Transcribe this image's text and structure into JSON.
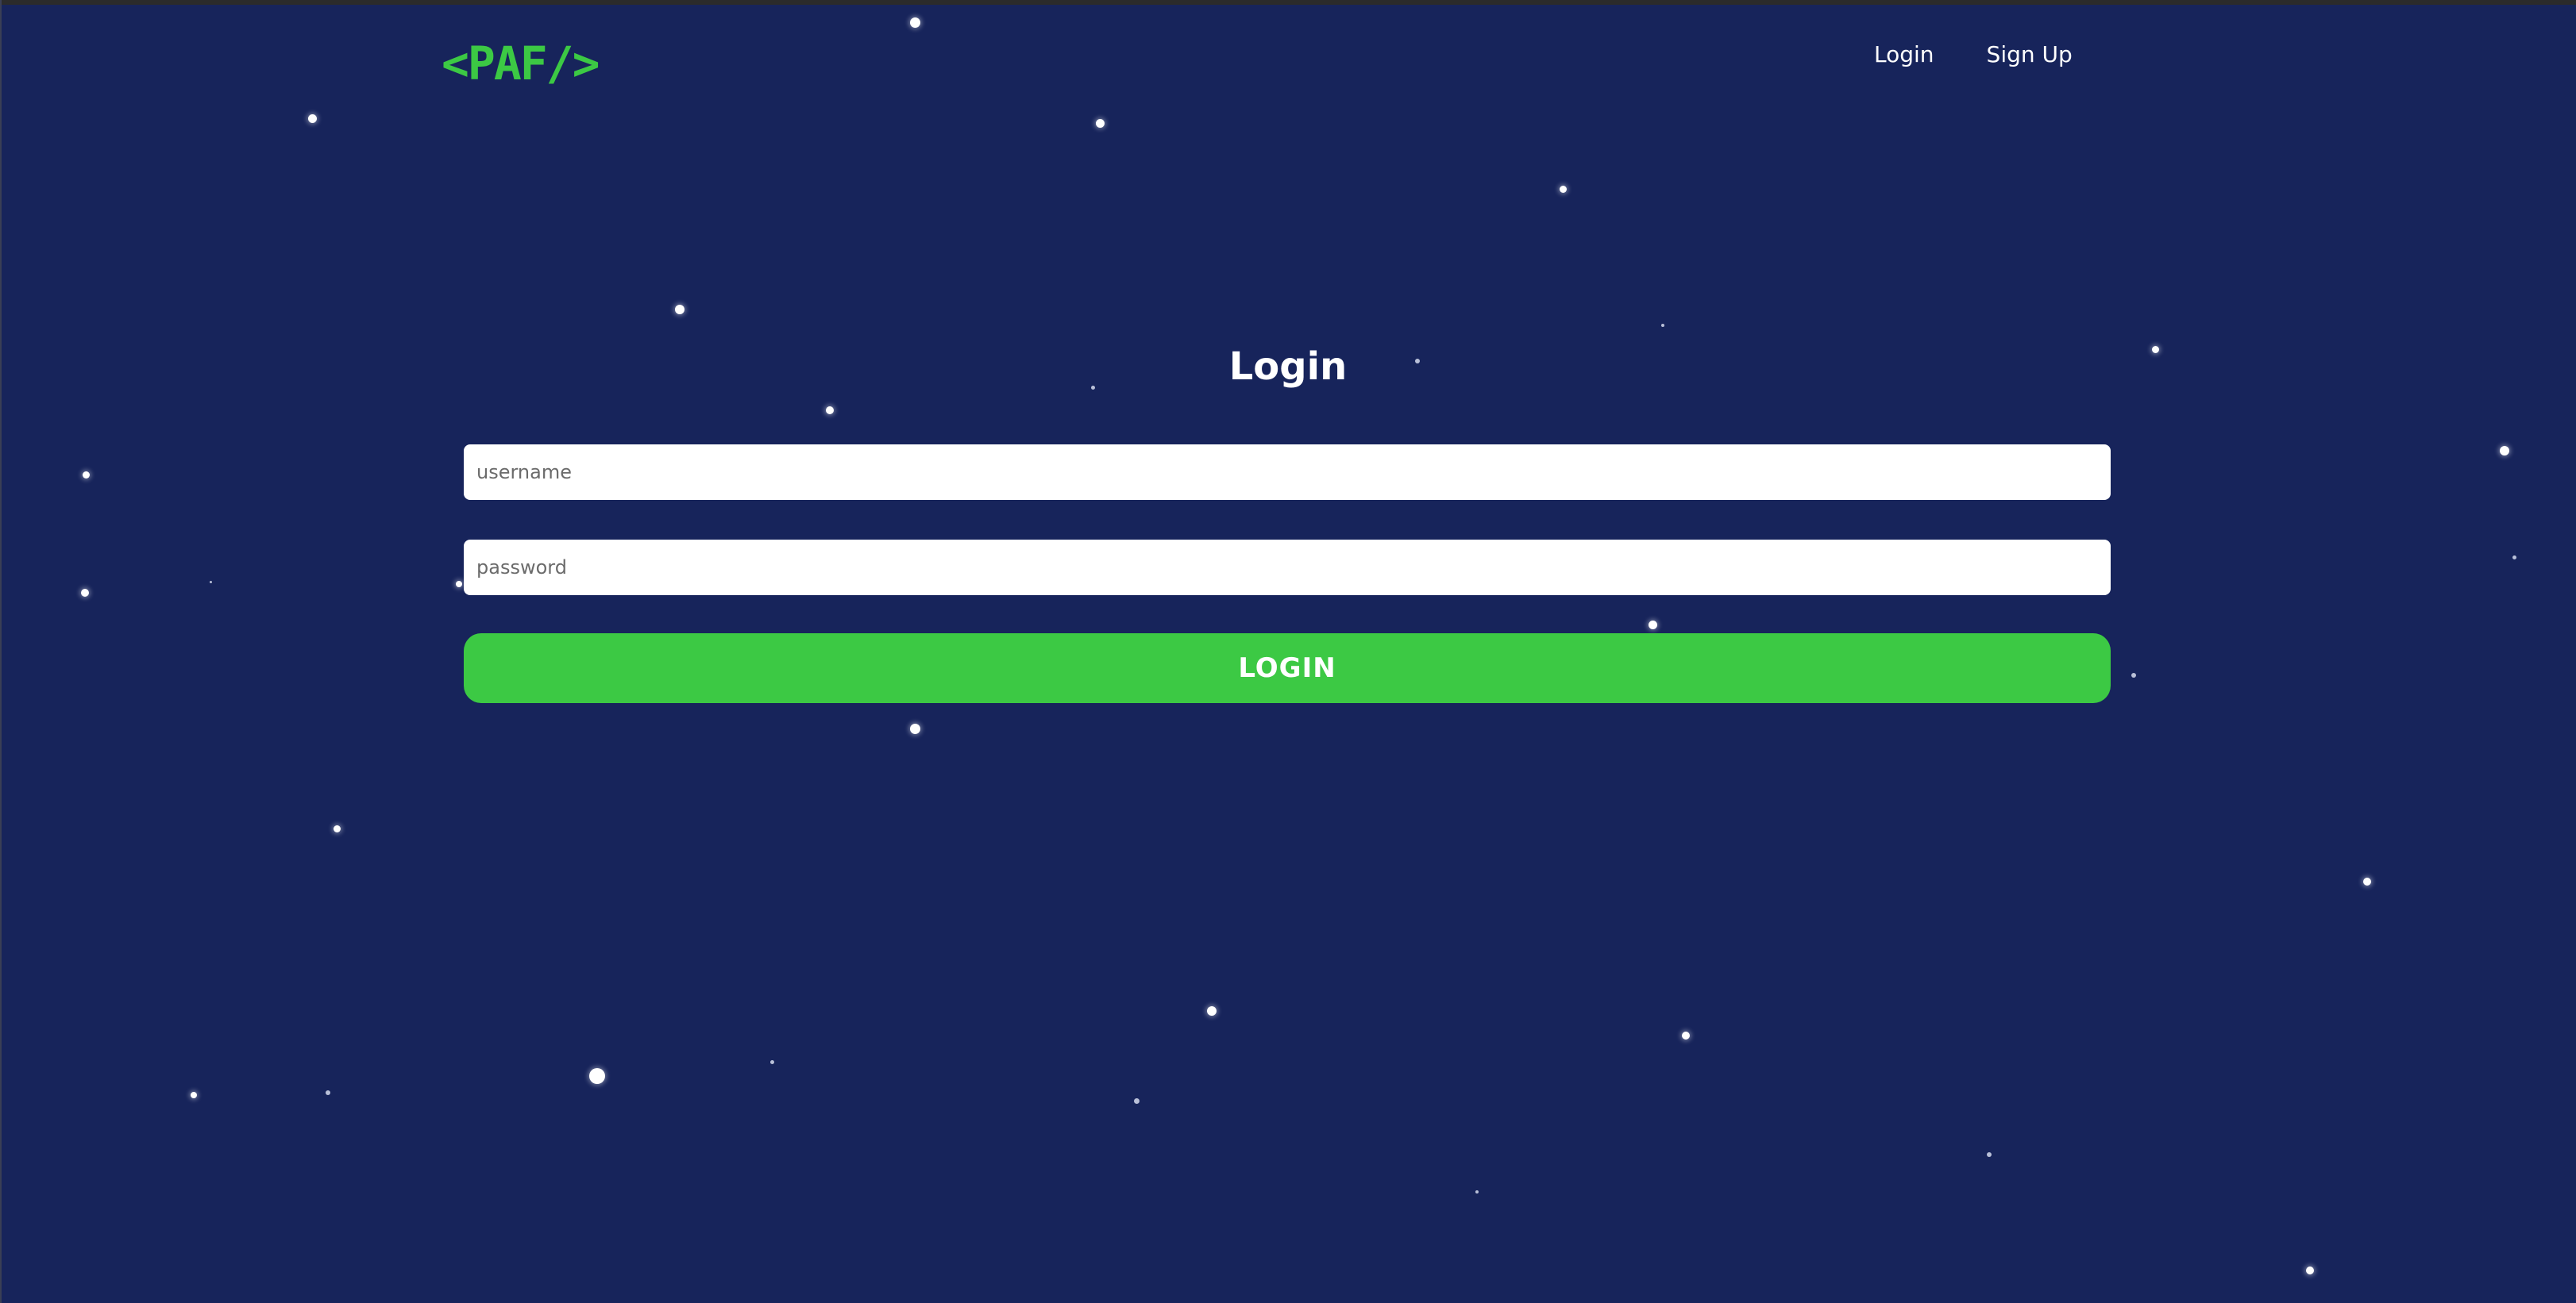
{
  "brand": {
    "logo_text": "<PAF/>",
    "accent_color": "#3cc944",
    "background_color": "#17245b"
  },
  "nav": {
    "login_label": "Login",
    "signup_label": "Sign Up"
  },
  "form": {
    "title": "Login",
    "username_placeholder": "username",
    "password_placeholder": "password",
    "submit_label": "LOGIN"
  }
}
